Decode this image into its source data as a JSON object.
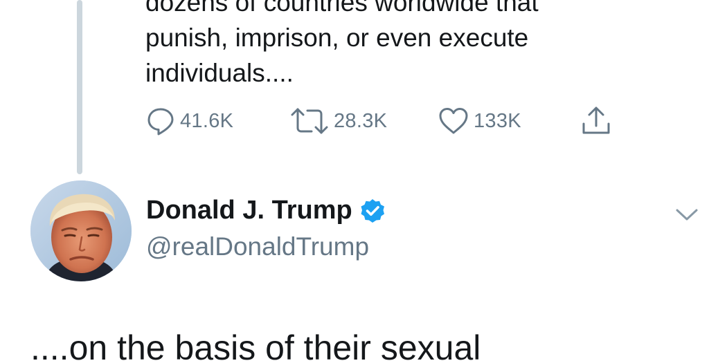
{
  "previous_tweet": {
    "text_lines": [
      "dozens of countries worldwide that",
      "punish, imprison, or even execute",
      "individuals...."
    ],
    "actions": {
      "replies": "41.6K",
      "retweets": "28.3K",
      "likes": "133K"
    }
  },
  "tweet": {
    "author_name": "Donald J. Trump",
    "handle": "@realDonaldTrump",
    "verified": true,
    "text": "....on the basis of their sexual"
  },
  "colors": {
    "text": "#14171a",
    "secondary": "#657786",
    "thread_line": "#ccd6dd",
    "verified_blue": "#1da1f2"
  }
}
